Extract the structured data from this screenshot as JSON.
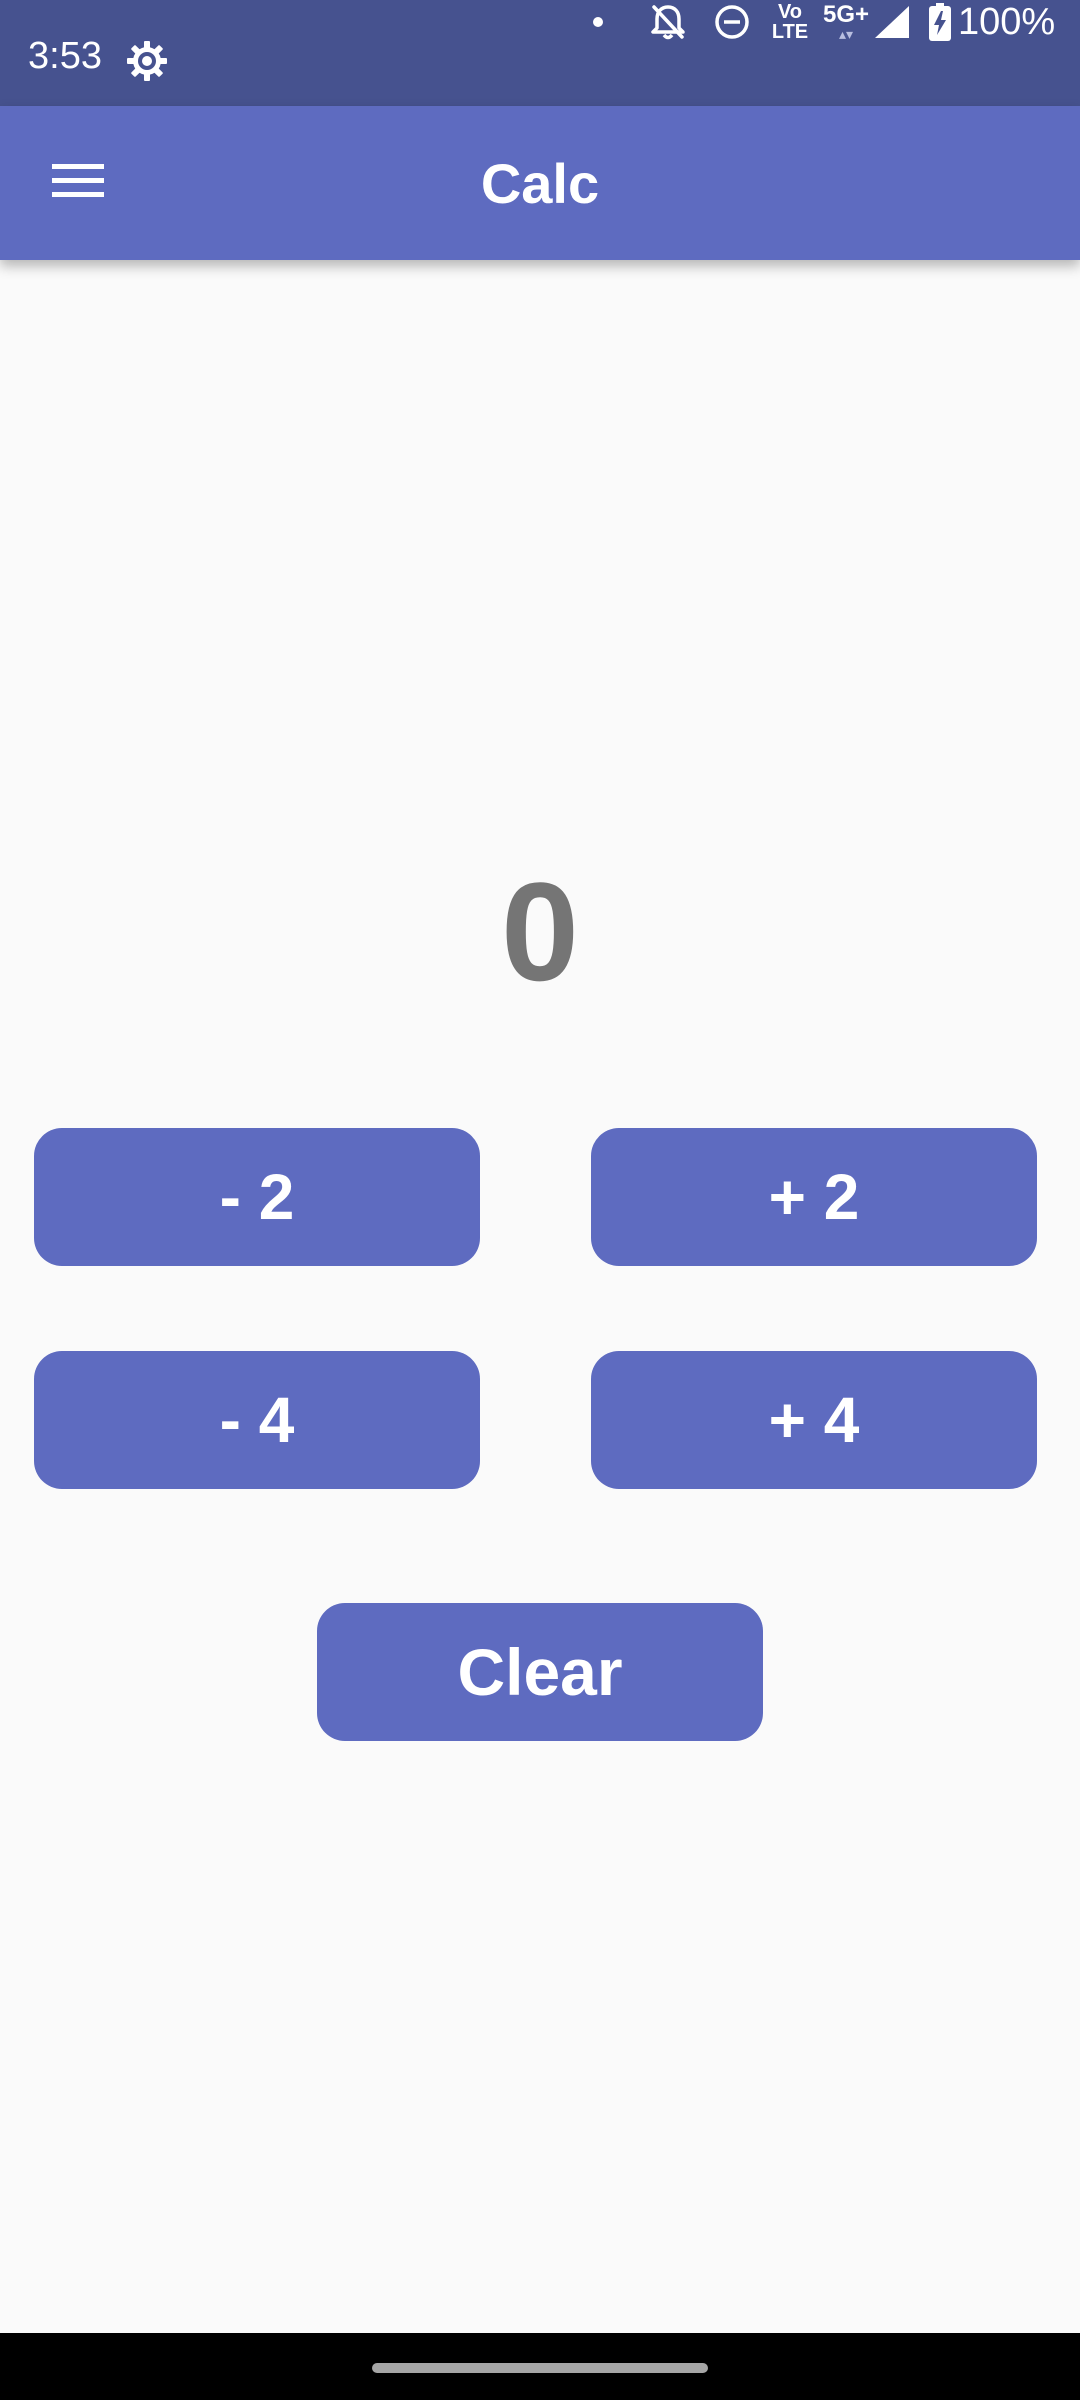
{
  "status_bar": {
    "time": "3:53",
    "network_top": "Vo",
    "network_bottom": "LTE",
    "signal_label": "5G+",
    "battery": "100%",
    "background_color": "#46528f",
    "icons": [
      "settings-gear-icon",
      "notification-dot-icon",
      "alarm-off-icon",
      "do-not-disturb-icon",
      "volte-icon",
      "5g-plus-icon",
      "cell-signal-icon",
      "battery-charging-icon"
    ]
  },
  "app_bar": {
    "title": "Calc",
    "menu_icon": "hamburger-menu-icon",
    "background_color": "#5e6bc0"
  },
  "display": {
    "value": "0",
    "color": "#757575"
  },
  "buttons": {
    "minus2": "- 2",
    "plus2": "+ 2",
    "minus4": "- 4",
    "plus4": "+ 4",
    "clear": "Clear",
    "color": "#5e6bc0",
    "text_color": "#ffffff"
  },
  "navigation_bar": {
    "home_handle_icon": "gesture-home-handle",
    "background_color": "#000000"
  }
}
